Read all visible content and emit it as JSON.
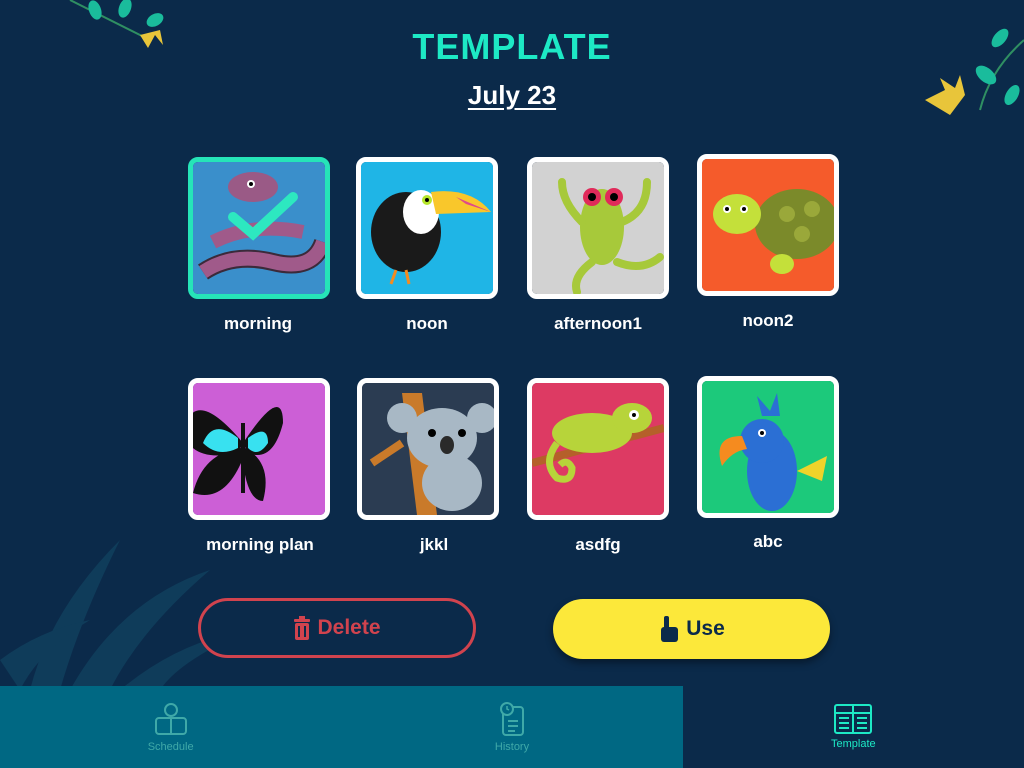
{
  "header": {
    "title": "TEMPLATE",
    "date": "July 23"
  },
  "templates": [
    {
      "label": "morning",
      "animal": "snake",
      "bg": "#3a8fcb",
      "selected": true
    },
    {
      "label": "noon",
      "animal": "toucan",
      "bg": "#1fb5e6",
      "selected": false
    },
    {
      "label": "afternoon1",
      "animal": "frog",
      "bg": "#d2d2d2",
      "selected": false
    },
    {
      "label": "noon2",
      "animal": "turtle",
      "bg": "#f55b2b",
      "selected": false
    },
    {
      "label": "morning plan",
      "animal": "butterfly",
      "bg": "#cc5fd6",
      "selected": false
    },
    {
      "label": "jkkl",
      "animal": "koala",
      "bg": "#2b3c52",
      "selected": false
    },
    {
      "label": "asdfg",
      "animal": "chameleon",
      "bg": "#dd3a63",
      "selected": false
    },
    {
      "label": "abc",
      "animal": "parrot",
      "bg": "#1cc97b",
      "selected": false
    }
  ],
  "actions": {
    "delete_label": "Delete",
    "delete_icon": "trash-icon",
    "use_label": "Use",
    "use_icon": "pointing-hand-icon"
  },
  "tabs": [
    {
      "label": "Schedule",
      "icon": "schedule-person-icon",
      "active": false
    },
    {
      "label": "History",
      "icon": "history-clipboard-icon",
      "active": false
    },
    {
      "label": "Template",
      "icon": "template-grid-icon",
      "active": true
    }
  ],
  "colors": {
    "background": "#0b2a4a",
    "accent": "#1de9c5",
    "delete": "#d1434e",
    "use": "#fce83a",
    "tab_inactive": "#006883"
  }
}
